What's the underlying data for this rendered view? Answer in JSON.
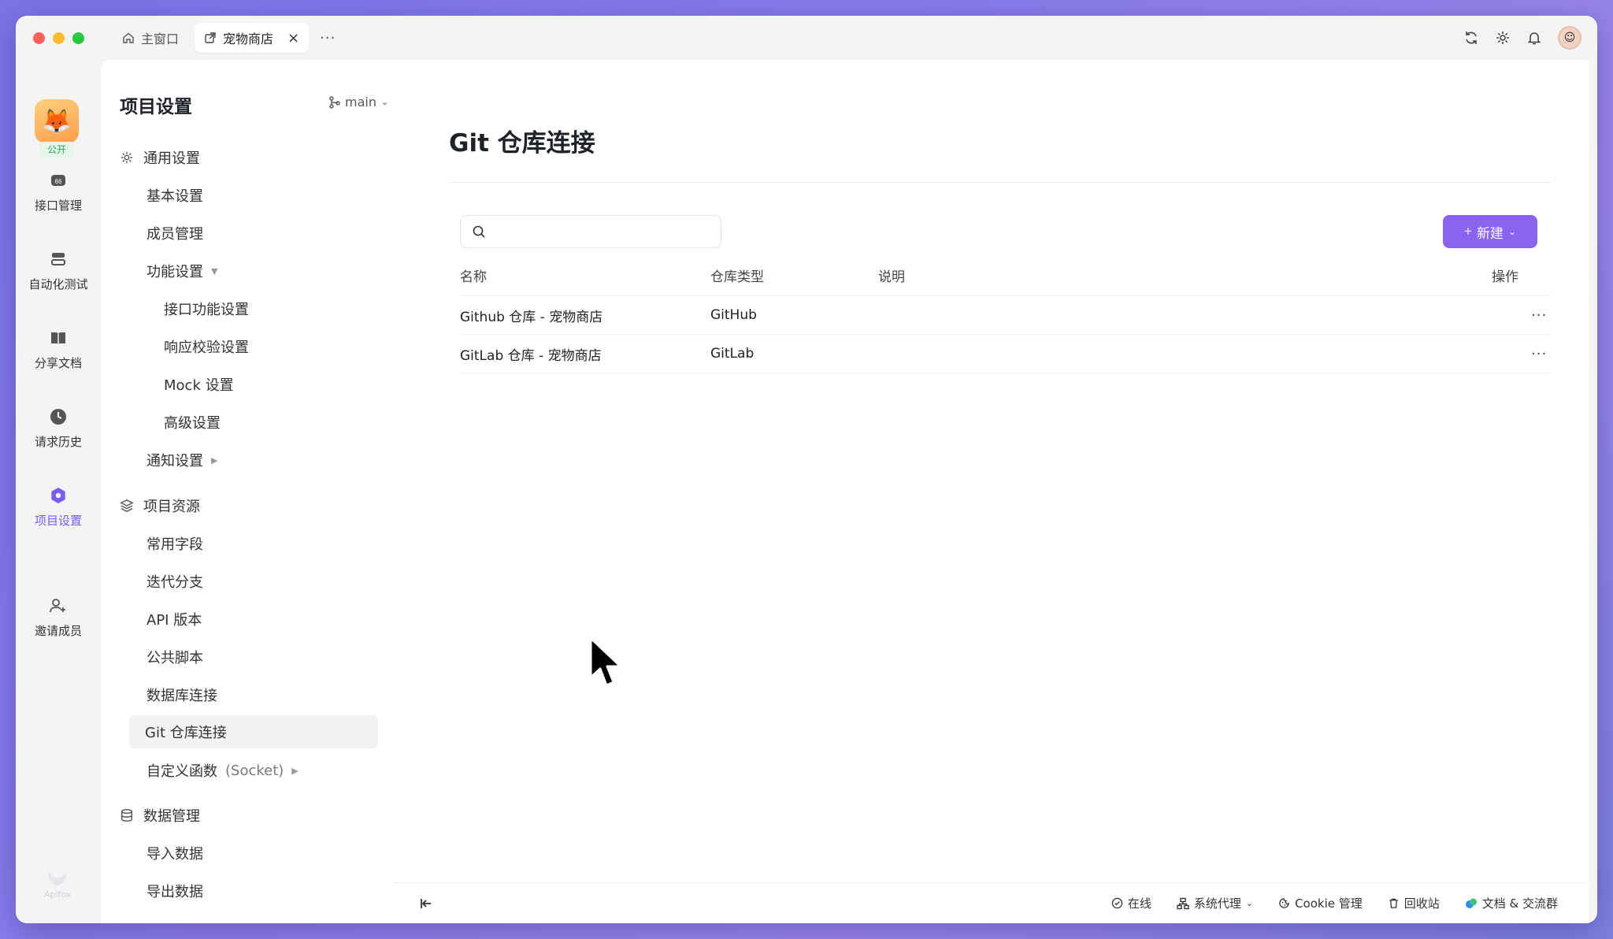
{
  "titlebar": {
    "tabs": [
      {
        "label": "主窗口"
      },
      {
        "label": "宠物商店"
      }
    ],
    "more": "···"
  },
  "rail": {
    "project_badge": "公开",
    "items": [
      {
        "label": "接口管理"
      },
      {
        "label": "自动化测试"
      },
      {
        "label": "分享文档"
      },
      {
        "label": "请求历史"
      },
      {
        "label": "项目设置"
      },
      {
        "label": "邀请成员"
      }
    ],
    "footer": "Apifox"
  },
  "sidebar": {
    "title": "项目设置",
    "branch": "main",
    "groups": {
      "general": "通用设置",
      "resources": "项目资源",
      "data": "数据管理"
    },
    "items": {
      "basic": "基本设置",
      "members": "成员管理",
      "features": "功能设置",
      "api_features": "接口功能设置",
      "response_validation": "响应校验设置",
      "mock": "Mock 设置",
      "advanced": "高级设置",
      "notifications": "通知设置",
      "common_fields": "常用字段",
      "iteration_branch": "迭代分支",
      "api_version": "API 版本",
      "public_scripts": "公共脚本",
      "db_connection": "数据库连接",
      "git_connection": "Git 仓库连接",
      "custom_functions": "自定义函数",
      "custom_functions_suffix": "(Socket)",
      "import_data": "导入数据",
      "export_data": "导出数据"
    }
  },
  "main": {
    "title": "Git 仓库连接",
    "search_placeholder": "",
    "new_button": "新建",
    "table": {
      "headers": [
        "名称",
        "仓库类型",
        "说明",
        "操作"
      ],
      "rows": [
        {
          "name": "Github 仓库 - 宠物商店",
          "type": "GitHub",
          "desc": "",
          "action": "···"
        },
        {
          "name": "GitLab 仓库 - 宠物商店",
          "type": "GitLab",
          "desc": "",
          "action": "···"
        }
      ]
    }
  },
  "statusbar": {
    "online": "在线",
    "proxy": "系统代理",
    "cookie": "Cookie 管理",
    "trash": "回收站",
    "docs": "文档 & 交流群"
  },
  "colors": {
    "accent": "#8a63f0",
    "active_nav": "#7a5af8",
    "public_badge": "#23a55a"
  }
}
